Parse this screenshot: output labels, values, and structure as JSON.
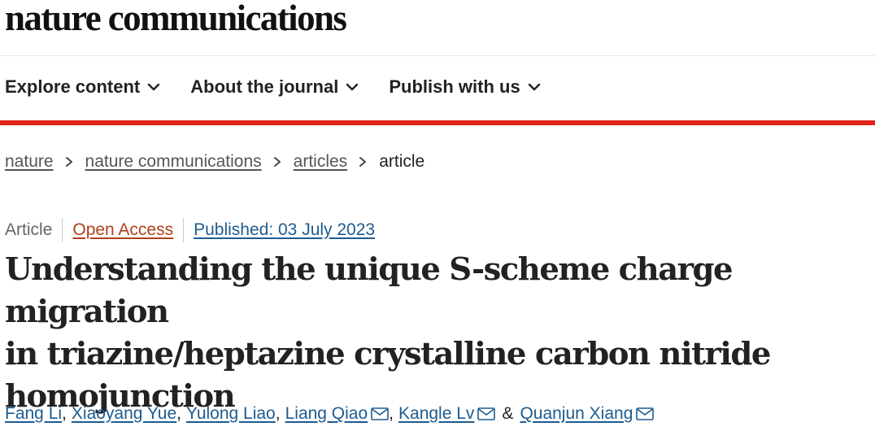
{
  "journal": {
    "name": "nature communications"
  },
  "nav": {
    "items": [
      {
        "label": "Explore content",
        "icon": "chevron-down-icon"
      },
      {
        "label": "About the journal",
        "icon": "chevron-down-icon"
      },
      {
        "label": "Publish with us",
        "icon": "chevron-down-icon"
      }
    ]
  },
  "breadcrumb": {
    "items": [
      "nature",
      "nature communications",
      "articles"
    ],
    "current": "article"
  },
  "article": {
    "type": "Article",
    "access": "Open Access",
    "published": "Published: 03 July 2023",
    "title_lines": [
      "Understanding the unique S-scheme charge migration",
      "in triazine/heptazine crystalline carbon nitride",
      "homojunction"
    ],
    "authors": [
      {
        "name": "Fang Li",
        "separator": ","
      },
      {
        "name": "Xiaoyang Yue",
        "separator": ","
      },
      {
        "name": "Yulong Liao",
        "separator": ","
      },
      {
        "name": "Liang Qiao",
        "separator": ","
      },
      {
        "name": "Kangle Lv",
        "separator": "&"
      },
      {
        "name": "Quanjun Xiang",
        "separator": ""
      }
    ],
    "amp": "&",
    "comma": ","
  },
  "colors": {
    "accent_red": "#e2231a",
    "link_blue": "#1e5b8f",
    "open_access": "#b0401d",
    "text": "#222222"
  }
}
